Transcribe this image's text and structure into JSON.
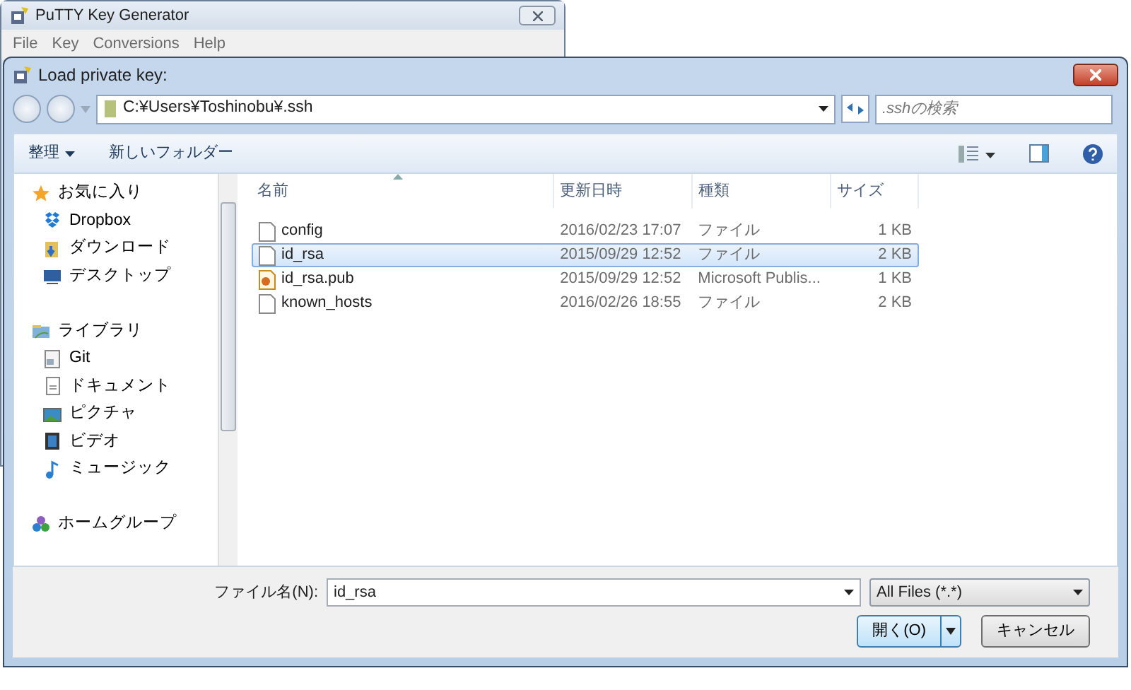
{
  "parent_window": {
    "title": "PuTTY Key Generator",
    "menu": [
      "File",
      "Key",
      "Conversions",
      "Help"
    ]
  },
  "dialog": {
    "title": "Load private key:",
    "address": "C:¥Users¥Toshinobu¥.ssh",
    "search": {
      "placeholder": ".sshの検索"
    },
    "toolbar": [
      {
        "label": "整理",
        "kind": "menu"
      },
      {
        "label": "新しいフォルダー",
        "kind": "button"
      }
    ],
    "sidebar": [
      {
        "label": "お気に入り",
        "kind": "favorites",
        "children": [
          {
            "label": "Dropbox",
            "kind": "dropbox"
          },
          {
            "label": "ダウンロード",
            "kind": "download"
          },
          {
            "label": "デスクトップ",
            "kind": "desktop"
          }
        ]
      },
      {
        "label": "ライブラリ",
        "kind": "library",
        "children": [
          {
            "label": "Git",
            "kind": "git"
          },
          {
            "label": "ドキュメント",
            "kind": "documents"
          },
          {
            "label": "ピクチャ",
            "kind": "pictures"
          },
          {
            "label": "ビデオ",
            "kind": "video"
          },
          {
            "label": "ミュージック",
            "kind": "music"
          }
        ]
      },
      {
        "label": "ホームグループ",
        "kind": "homegroup"
      }
    ],
    "columns": [
      {
        "label": "名前",
        "sorted": true
      },
      {
        "label": "更新日時",
        "sorted": false
      },
      {
        "label": "種類",
        "sorted": false
      },
      {
        "label": "サイズ",
        "sorted": false
      }
    ],
    "rows": [
      {
        "name": "config",
        "modified": "2016/02/23 17:07",
        "type": "ファイル",
        "size": "1 KB",
        "kind": "file",
        "selected": false
      },
      {
        "name": "id_rsa",
        "modified": "2015/09/29 12:52",
        "type": "ファイル",
        "size": "2 KB",
        "kind": "file",
        "selected": true
      },
      {
        "name": "id_rsa.pub",
        "modified": "2015/09/29 12:52",
        "type": "Microsoft Publis...",
        "size": "1 KB",
        "kind": "publisher",
        "selected": false
      },
      {
        "name": "known_hosts",
        "modified": "2016/02/26 18:55",
        "type": "ファイル",
        "size": "2 KB",
        "kind": "file",
        "selected": false
      }
    ],
    "filename_label": "ファイル名(N):",
    "filename": "id_rsa",
    "filter": "All Files (*.*)",
    "buttons": [
      {
        "label": "開く(O)",
        "kind": "split"
      },
      {
        "label": "キャンセル",
        "kind": "plain"
      }
    ]
  }
}
